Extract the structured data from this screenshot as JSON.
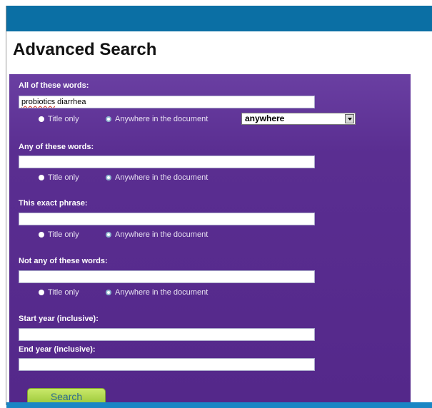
{
  "page": {
    "title": "Advanced Search"
  },
  "colors": {
    "header": "#0b6fa4",
    "panel": "#5a2e91",
    "button": "#a8d046"
  },
  "form": {
    "all_words": {
      "label": "All of these words:",
      "value_misspelled": "probiotics",
      "value_rest": " diarrhea",
      "title_only": "Title only",
      "anywhere": "Anywhere in the document",
      "selected": "anywhere",
      "location_select": "anywhere"
    },
    "any_words": {
      "label": "Any of these words:",
      "value": "",
      "title_only": "Title only",
      "anywhere": "Anywhere in the document",
      "selected": "anywhere"
    },
    "exact_phrase": {
      "label": "This exact phrase:",
      "value": "",
      "title_only": "Title only",
      "anywhere": "Anywhere in the document",
      "selected": "anywhere"
    },
    "not_words": {
      "label": "Not any of these words:",
      "value": "",
      "title_only": "Title only",
      "anywhere": "Anywhere in the document",
      "selected": "anywhere"
    },
    "start_year": {
      "label": "Start year (inclusive):",
      "value": ""
    },
    "end_year": {
      "label": "End year (inclusive):",
      "value": ""
    },
    "search_label": "Search"
  }
}
